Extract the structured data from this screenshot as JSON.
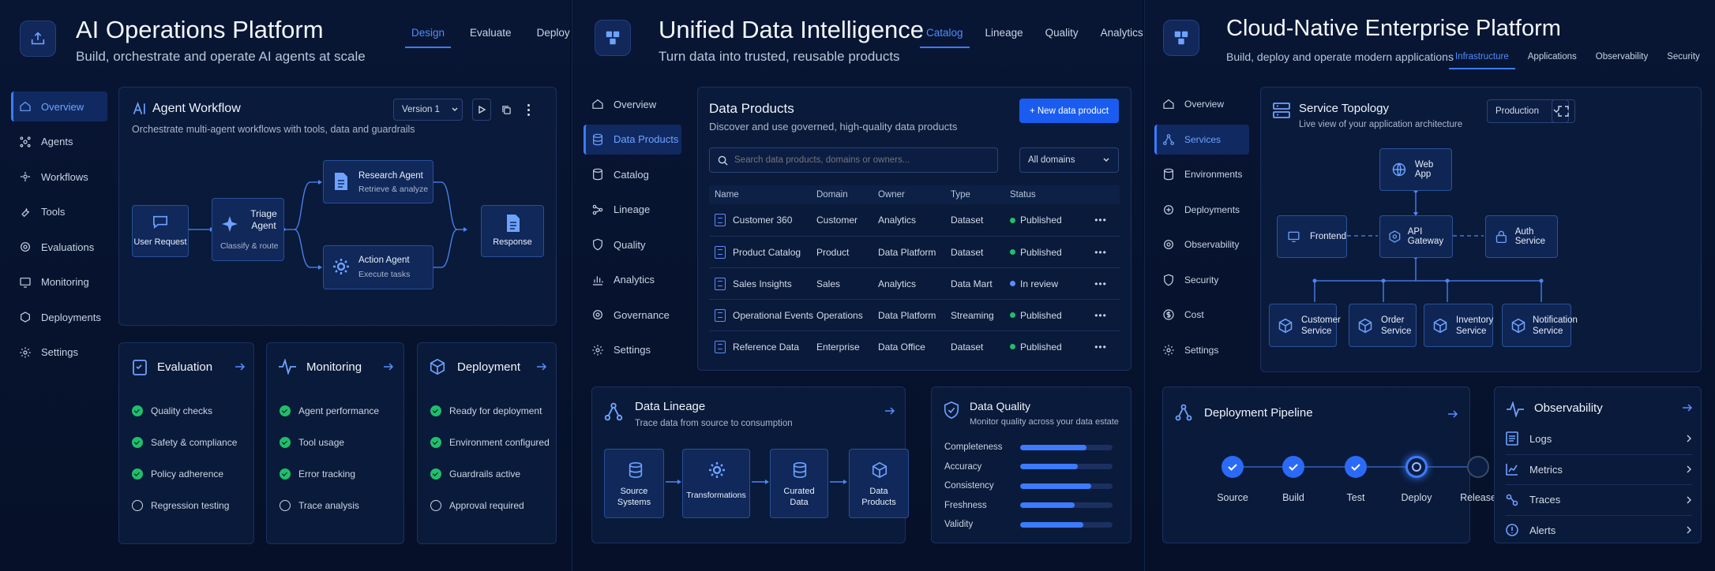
{
  "panels": {
    "ai": {
      "title": "AI Operations Platform",
      "subtitle": "Build, orchestrate and operate AI agents at scale",
      "tabs": [
        "Design",
        "Evaluate",
        "Deploy"
      ],
      "nav": [
        "Overview",
        "Agents",
        "Workflows",
        "Tools",
        "Evaluations",
        "Monitoring",
        "Deployments",
        "Settings"
      ],
      "workflow": {
        "title": "Agent Workflow",
        "subtitle": "Orchestrate multi-agent workflows with tools, data and guardrails",
        "version": "Version 1",
        "nodes": {
          "user": "User Request",
          "triage": "Triage Agent",
          "triage_sub": "Classify & route",
          "research": "Research Agent",
          "research_sub": "Retrieve & analyze",
          "action": "Action Agent",
          "action_sub": "Execute tasks",
          "response": "Response"
        }
      },
      "evaluation": {
        "title": "Evaluation",
        "items": [
          {
            "label": "Quality checks",
            "done": true
          },
          {
            "label": "Safety & compliance",
            "done": true
          },
          {
            "label": "Policy adherence",
            "done": true
          },
          {
            "label": "Regression testing",
            "done": false
          }
        ]
      },
      "monitoring": {
        "title": "Monitoring",
        "items": [
          {
            "label": "Agent performance",
            "done": true
          },
          {
            "label": "Tool usage",
            "done": true
          },
          {
            "label": "Error tracking",
            "done": true
          },
          {
            "label": "Trace analysis",
            "done": false
          }
        ]
      },
      "deployment": {
        "title": "Deployment",
        "items": [
          {
            "label": "Ready for deployment",
            "done": true
          },
          {
            "label": "Environment configured",
            "done": true
          },
          {
            "label": "Guardrails active",
            "done": true
          },
          {
            "label": "Approval required",
            "done": false
          }
        ]
      }
    },
    "data": {
      "title": "Unified Data Intelligence",
      "subtitle": "Turn data into trusted, reusable products",
      "tabs": [
        "Catalog",
        "Lineage",
        "Quality",
        "Analytics"
      ],
      "nav": [
        "Overview",
        "Data Products",
        "Catalog",
        "Lineage",
        "Quality",
        "Analytics",
        "Governance",
        "Settings"
      ],
      "products": {
        "title": "Data Products",
        "subtitle": "Discover and use governed, high-quality data products",
        "new_button": "+ New data product",
        "search_placeholder": "Search data products, domains or owners...",
        "filter": "All domains",
        "columns": [
          "Name",
          "Domain",
          "Owner",
          "Type",
          "Status"
        ],
        "rows": [
          {
            "name": "Customer 360",
            "domain": "Customer",
            "owner": "Analytics",
            "type": "Dataset",
            "status": "Published"
          },
          {
            "name": "Product Catalog",
            "domain": "Product",
            "owner": "Data Platform",
            "type": "Dataset",
            "status": "Published"
          },
          {
            "name": "Sales Insights",
            "domain": "Sales",
            "owner": "Analytics",
            "type": "Data Mart",
            "status": "In review"
          },
          {
            "name": "Operational Events",
            "domain": "Operations",
            "owner": "Data Platform",
            "type": "Streaming",
            "status": "Published"
          },
          {
            "name": "Reference Data",
            "domain": "Enterprise",
            "owner": "Data Office",
            "type": "Dataset",
            "status": "Published"
          }
        ]
      },
      "lineage": {
        "title": "Data Lineage",
        "subtitle": "Trace data from source to consumption",
        "nodes": [
          "Source Systems",
          "Transformations",
          "Curated Data",
          "Data Products"
        ]
      },
      "quality": {
        "title": "Data Quality",
        "subtitle": "Monitor quality across your data estate",
        "metrics": [
          {
            "label": "Completeness",
            "value": 0.72
          },
          {
            "label": "Accuracy",
            "value": 0.62
          },
          {
            "label": "Consistency",
            "value": 0.77
          },
          {
            "label": "Freshness",
            "value": 0.59
          },
          {
            "label": "Validity",
            "value": 0.68
          }
        ]
      }
    },
    "cloud": {
      "title": "Cloud-Native Enterprise Platform",
      "subtitle": "Build, deploy and operate modern applications",
      "tabs": [
        "Infrastructure",
        "Applications",
        "Observability",
        "Security"
      ],
      "nav": [
        "Overview",
        "Services",
        "Environments",
        "Deployments",
        "Observability",
        "Security",
        "Cost",
        "Settings"
      ],
      "topology": {
        "title": "Service Topology",
        "subtitle": "Live view of your application architecture",
        "env": "Production",
        "services": {
          "web": "Web App",
          "frontend": "Frontend",
          "gateway": "API Gateway",
          "auth": "Auth Service",
          "customer": "Customer Service",
          "order": "Order Service",
          "inventory": "Inventory Service",
          "notification": "Notification Service"
        }
      },
      "pipeline": {
        "title": "Deployment Pipeline",
        "steps": [
          {
            "label": "Source",
            "state": "done"
          },
          {
            "label": "Build",
            "state": "done"
          },
          {
            "label": "Test",
            "state": "done"
          },
          {
            "label": "Deploy",
            "state": "active"
          },
          {
            "label": "Release",
            "state": "pending"
          }
        ]
      },
      "observability": {
        "title": "Observability",
        "items": [
          "Logs",
          "Metrics",
          "Traces",
          "Alerts"
        ]
      }
    }
  },
  "colors": {
    "accent": "#3c7bff",
    "success": "#1fbf6a",
    "review": "#5b8cff"
  }
}
